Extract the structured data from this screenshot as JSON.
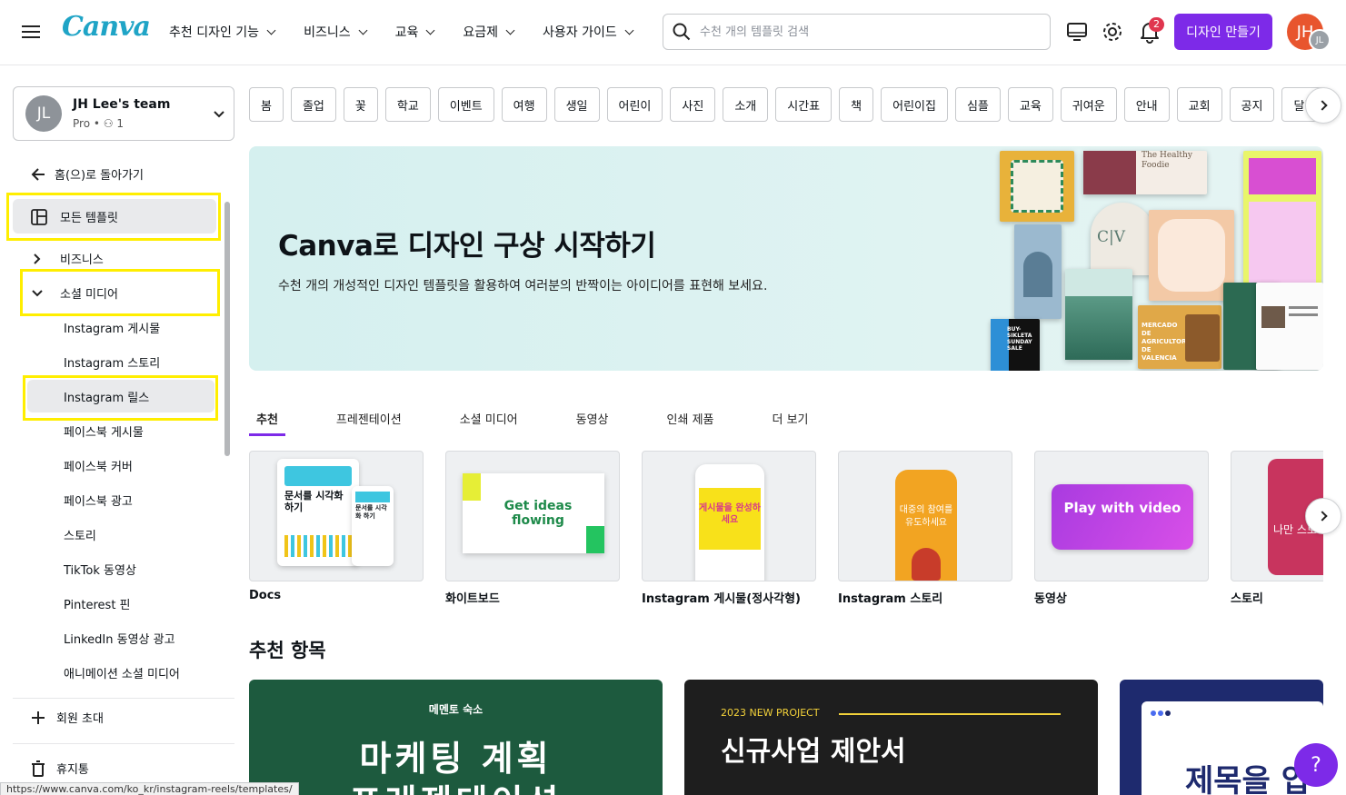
{
  "header": {
    "logo": "Canva",
    "nav": [
      "추천 디자인 기능",
      "비즈니스",
      "교육",
      "요금제",
      "사용자 가이드"
    ],
    "search_placeholder": "수천 개의 템플릿 검색",
    "notifications_count": "2",
    "create_button": "디자인 만들기",
    "avatar_initials": "JH",
    "avatar_small_initials": "JL"
  },
  "sidebar": {
    "team_initials": "JL",
    "team_name": "JH Lee's team",
    "team_plan": "Pro • ⚇ 1",
    "back_label": "홈(으)로 돌아가기",
    "all_templates": "모든 템플릿",
    "business": "비즈니스",
    "social_media": "소셜 미디어",
    "sub_items": [
      "Instagram 게시물",
      "Instagram 스토리",
      "Instagram 릴스",
      "페이스북 게시물",
      "페이스북 커버",
      "페이스북 광고",
      "스토리",
      "TikTok 동영상",
      "Pinterest 핀",
      "LinkedIn 동영상 광고",
      "애니메이션 소셜 미디어"
    ],
    "invite": "회원 초대",
    "trash": "휴지통"
  },
  "chips": [
    "봄",
    "졸업",
    "꽃",
    "학교",
    "이벤트",
    "여행",
    "생일",
    "어린이",
    "사진",
    "소개",
    "시간표",
    "책",
    "어린이집",
    "심플",
    "교육",
    "귀여운",
    "안내",
    "교회",
    "공지",
    "달력"
  ],
  "hero": {
    "title": "Canva로 디자인 구상 시작하기",
    "subtitle": "수천 개의 개성적인 디자인 템플릿을 활용하여 여러분의 반짝이는 아이디어를 표현해 보세요.",
    "card_texts": {
      "foodie": "The Healthy Foodie",
      "cv": "C|V",
      "mercado": "MERCADO DE AGRICULTORES DE VALENCIA",
      "bike": "BUY- SIKLETA SUNDAY SALE"
    }
  },
  "tabs": [
    "추천",
    "프레젠테이션",
    "소셜 미디어",
    "동영상",
    "인쇄 제품",
    "더 보기"
  ],
  "design_types": {
    "labels": [
      "Docs",
      "화이트보드",
      "Instagram 게시물(정사각형)",
      "Instagram 스토리",
      "동영상",
      "스토리"
    ],
    "thumb_texts": {
      "docs": "문서를 시각화하기",
      "docs_small": "문서를 시각화 하기",
      "whiteboard": "Get ideas flowing",
      "post": "게시물을 완성하세요",
      "story": "대중의 참여를 유도하세요",
      "video": "Play with video",
      "story2": "나만 스토리"
    }
  },
  "featured": {
    "title": "추천 항목",
    "cards": [
      {
        "kicker": "메멘토 숙소",
        "title": "마케팅 계획",
        "title2": "프레젠테이션"
      },
      {
        "kicker": "2023 NEW PROJECT",
        "title": "신규사업 제안서"
      },
      {
        "title": "제목을 입"
      }
    ]
  },
  "help_label": "?",
  "status_url": "https://www.canva.com/ko_kr/instagram-reels/templates/",
  "colors": {
    "accent": "#7d2ae8",
    "highlight": "#ffee00",
    "hero_bg": "#d5f0ef"
  }
}
